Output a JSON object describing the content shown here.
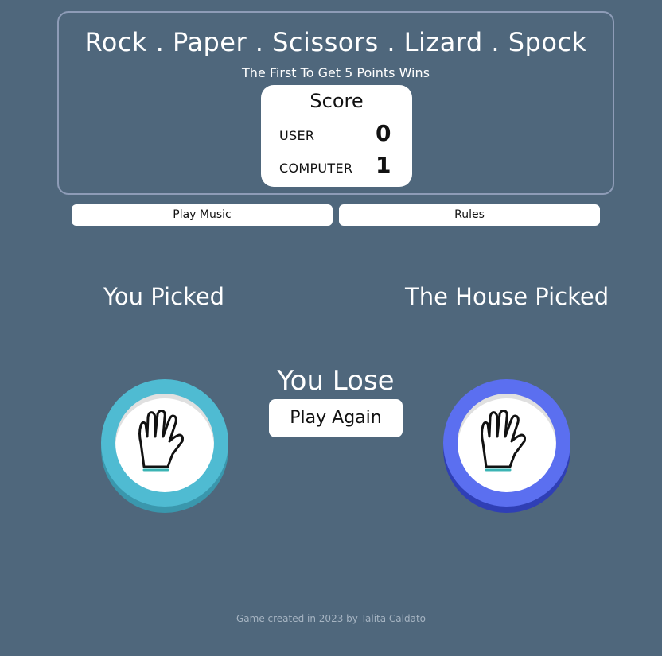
{
  "header": {
    "title": "Rock . Paper . Scissors . Lizard . Spock",
    "subtitle": "The First To Get 5 Points Wins"
  },
  "score": {
    "title": "Score",
    "rows": [
      {
        "label": "USER",
        "value": "0"
      },
      {
        "label": "COMPUTER",
        "value": "1"
      }
    ]
  },
  "controls": {
    "music_label": "Play Music",
    "rules_label": "Rules"
  },
  "game": {
    "you_picked_label": "You Picked",
    "house_picked_label": "The House Picked",
    "result_text": "You Lose",
    "play_again_label": "Play Again",
    "user_pick": {
      "icon": "spock-hand-icon",
      "ring_color": "#4fbbd2",
      "shadow_color": "#3a97ad"
    },
    "house_pick": {
      "icon": "spock-hand-icon",
      "ring_color": "#5b6ff0",
      "shadow_color": "#2f3fb5"
    }
  },
  "footer": {
    "credit": "Game created in 2023 by Talita Caldato"
  }
}
